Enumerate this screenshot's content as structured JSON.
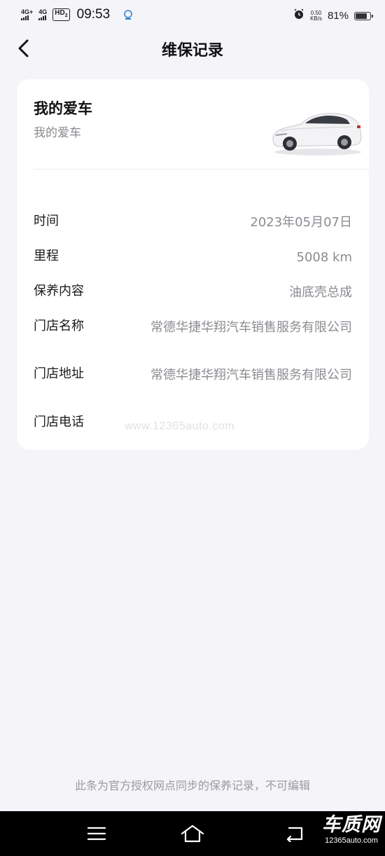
{
  "status_bar": {
    "signal_1": "4G+",
    "signal_2": "4G",
    "hd_label": "HD",
    "hd_sub": "2",
    "time": "09:53",
    "net_speed_value": "0.50",
    "net_speed_unit": "KB/s",
    "battery_percent": "81%",
    "battery_level": 0.81
  },
  "header": {
    "title": "维保记录",
    "back_icon": "chevron-left-icon"
  },
  "vehicle": {
    "name": "我的爱车",
    "subtitle": "我的爱车"
  },
  "details": [
    {
      "label": "时间",
      "value": "2023年05月07日"
    },
    {
      "label": "里程",
      "value": "5008 km"
    },
    {
      "label": "保养内容",
      "value": "油底壳总成"
    },
    {
      "label": "门店名称",
      "value": "常德华捷华翔汽车销售服务有限公司"
    },
    {
      "label": "门店地址",
      "value": "常德华捷华翔汽车销售服务有限公司"
    },
    {
      "label": "门店电话",
      "value": ""
    }
  ],
  "watermark": "www.12365auto.com",
  "footer_note": "此条为官方授权网点同步的保养记录，不可编辑",
  "nav": {
    "menu_icon": "menu-icon",
    "home_icon": "home-icon",
    "back_icon": "return-icon"
  },
  "brand": {
    "name": "车质网",
    "url": "12365auto.com"
  },
  "colors": {
    "background": "#f4f4f9",
    "card": "#ffffff",
    "value_text": "#8c8c92",
    "navbar": "#000000"
  }
}
